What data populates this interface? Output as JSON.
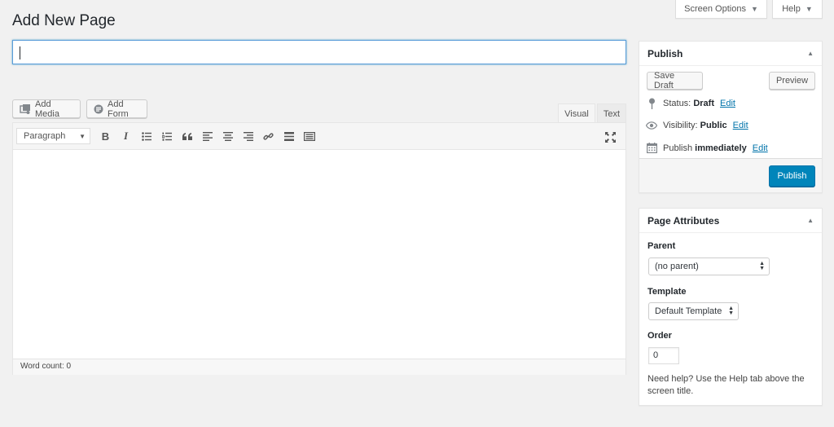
{
  "header": {
    "title": "Add New Page",
    "screen_options": "Screen Options",
    "help": "Help"
  },
  "title_field": {
    "value": ""
  },
  "media_buttons": {
    "add_media": "Add Media",
    "add_form": "Add Form"
  },
  "editor": {
    "tabs": {
      "visual": "Visual",
      "text": "Text"
    },
    "active_tab": "Visual",
    "format_select": "Paragraph",
    "toolbar_icons": [
      "bold-icon",
      "italic-icon",
      "bulleted-list-icon",
      "numbered-list-icon",
      "blockquote-icon",
      "align-left-icon",
      "align-center-icon",
      "align-right-icon",
      "link-icon",
      "read-more-icon",
      "toolbar-toggle-icon",
      "fullscreen-icon"
    ],
    "bold_glyph": "B",
    "italic_glyph": "I",
    "word_count": "Word count: 0"
  },
  "publish": {
    "title": "Publish",
    "save_draft": "Save Draft",
    "preview": "Preview",
    "status_label": "Status:",
    "status_value": "Draft",
    "visibility_label": "Visibility:",
    "visibility_value": "Public",
    "schedule_label": "Publish",
    "schedule_value": "immediately",
    "edit_link": "Edit",
    "publish_button": "Publish"
  },
  "page_attributes": {
    "title": "Page Attributes",
    "parent_label": "Parent",
    "parent_value": "(no parent)",
    "template_label": "Template",
    "template_value": "Default Template",
    "order_label": "Order",
    "order_value": "0",
    "help_text": "Need help? Use the Help tab above the screen title."
  },
  "colors": {
    "primary": "#0085ba",
    "link": "#0073aa",
    "background": "#f1f1f1"
  }
}
